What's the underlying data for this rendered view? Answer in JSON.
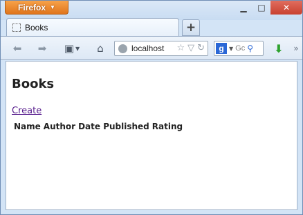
{
  "browser": {
    "app_button": "Firefox",
    "tab_title": "Books",
    "new_tab": "+",
    "url": "localhost",
    "search_placeholder": "Gc"
  },
  "page": {
    "title": "Books",
    "create_link": "Create",
    "table_headers": [
      "Name",
      "Author",
      "Date Published",
      "Rating"
    ]
  },
  "colors": {
    "firefox_button": "#e0751c",
    "close_button": "#c8402f",
    "visited_link": "#551a8b"
  }
}
